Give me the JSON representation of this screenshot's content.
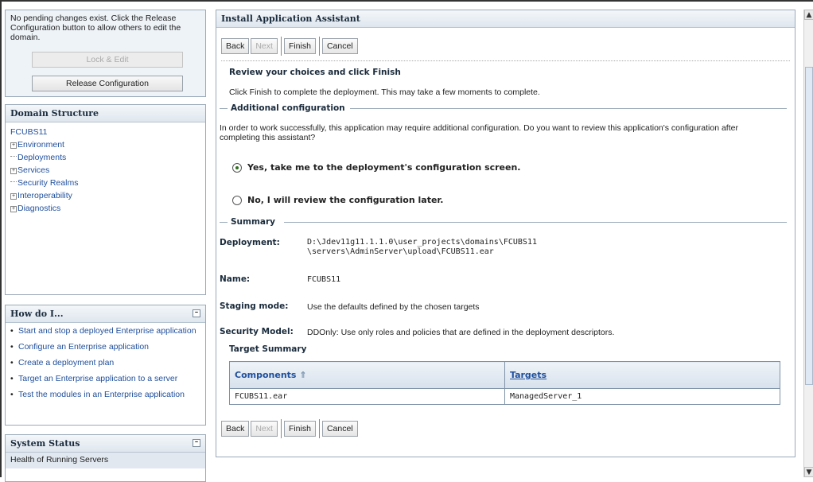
{
  "change_center": {
    "message": "No pending changes exist. Click the Release Configuration button to allow others to edit the domain.",
    "lock_edit_label": "Lock & Edit",
    "release_label": "Release Configuration"
  },
  "domain_structure": {
    "title": "Domain Structure",
    "root": "FCUBS11",
    "items": [
      {
        "label": "Environment",
        "expandable": true
      },
      {
        "label": "Deployments",
        "expandable": false
      },
      {
        "label": "Services",
        "expandable": true
      },
      {
        "label": "Security Realms",
        "expandable": false
      },
      {
        "label": "Interoperability",
        "expandable": true
      },
      {
        "label": "Diagnostics",
        "expandable": true
      }
    ]
  },
  "how_do_i": {
    "title": "How do I...",
    "items": [
      "Start and stop a deployed Enterprise application",
      "Configure an Enterprise application",
      "Create a deployment plan",
      "Target an Enterprise application to a server",
      "Test the modules in an Enterprise application"
    ]
  },
  "system_status": {
    "title": "System Status",
    "row": "Health of Running Servers"
  },
  "assistant": {
    "title": "Install Application Assistant",
    "buttons": {
      "back": "Back",
      "next": "Next",
      "finish": "Finish",
      "cancel": "Cancel"
    },
    "review_title": "Review your choices and click Finish",
    "review_text": "Click Finish to complete the deployment. This may take a few moments to complete.",
    "additional_title": "Additional configuration",
    "additional_text": "In order to work successfully, this application may require additional configuration. Do you want to review this application's configuration after completing this assistant?",
    "radio_yes": "Yes, take me to the deployment's configuration screen.",
    "radio_no": "No, I will review the configuration later.",
    "selected_option": "yes",
    "summary_title": "Summary",
    "summary": {
      "deployment_label": "Deployment:",
      "deployment_line1": "D:\\Jdev11g11.1.1.0\\user_projects\\domains\\FCUBS11",
      "deployment_line2": "\\servers\\AdminServer\\upload\\FCUBS11.ear",
      "name_label": "Name:",
      "name_value": "FCUBS11",
      "staging_label": "Staging mode:",
      "staging_value": "Use the defaults defined by the chosen targets",
      "security_label": "Security Model:",
      "security_value": "DDOnly: Use only roles and policies that are defined in the deployment descriptors."
    },
    "target_summary_title": "Target Summary",
    "table": {
      "col_components": "Components",
      "col_targets": "Targets",
      "rows": [
        {
          "component": "FCUBS11.ear",
          "target": "ManagedServer_1"
        }
      ]
    }
  }
}
